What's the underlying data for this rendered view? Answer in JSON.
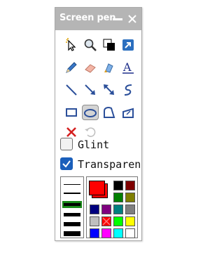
{
  "window": {
    "title": "Screen pen"
  },
  "title_icons": {
    "minimize": "minimize-icon",
    "close": "close-icon"
  },
  "tool_rows": [
    [
      "magic-pointer-icon",
      "magnifier-icon",
      "screen-mode-icon",
      "shortcut-icon"
    ],
    [
      "pen-icon",
      "eraser-icon",
      "highlighter-icon",
      "text-icon"
    ],
    [
      "line-icon",
      "arrow-icon",
      "double-arrow-icon",
      "curve-icon"
    ],
    [
      "rectangle-icon",
      "ellipse-icon",
      "freeform-shape-icon",
      "fill-icon"
    ],
    [
      "clear-all-icon",
      "undo-icon"
    ]
  ],
  "selected_tool": "ellipse-icon",
  "tool_text_glyph": "A",
  "options": {
    "glint": {
      "label": "Glint",
      "checked": false
    },
    "transparent": {
      "label": "Transparen",
      "checked": true
    }
  },
  "line_widths": {
    "count": 6,
    "selected_index": 2
  },
  "current_color": "#ff0000",
  "palette": [
    [
      "#000000",
      "#7f0000"
    ],
    [
      "#007f00",
      "#7f7f00"
    ],
    [
      "#00007f",
      "#7f007f",
      "#007f7f",
      "#7f7f7f"
    ],
    [
      "#bfbfbf",
      "#ff0000",
      "#00ff00",
      "#ffff00"
    ],
    [
      "#0000ff",
      "#ff00ff",
      "#00ffff",
      "#ffffff"
    ]
  ],
  "palette_selected": "#ff0000"
}
